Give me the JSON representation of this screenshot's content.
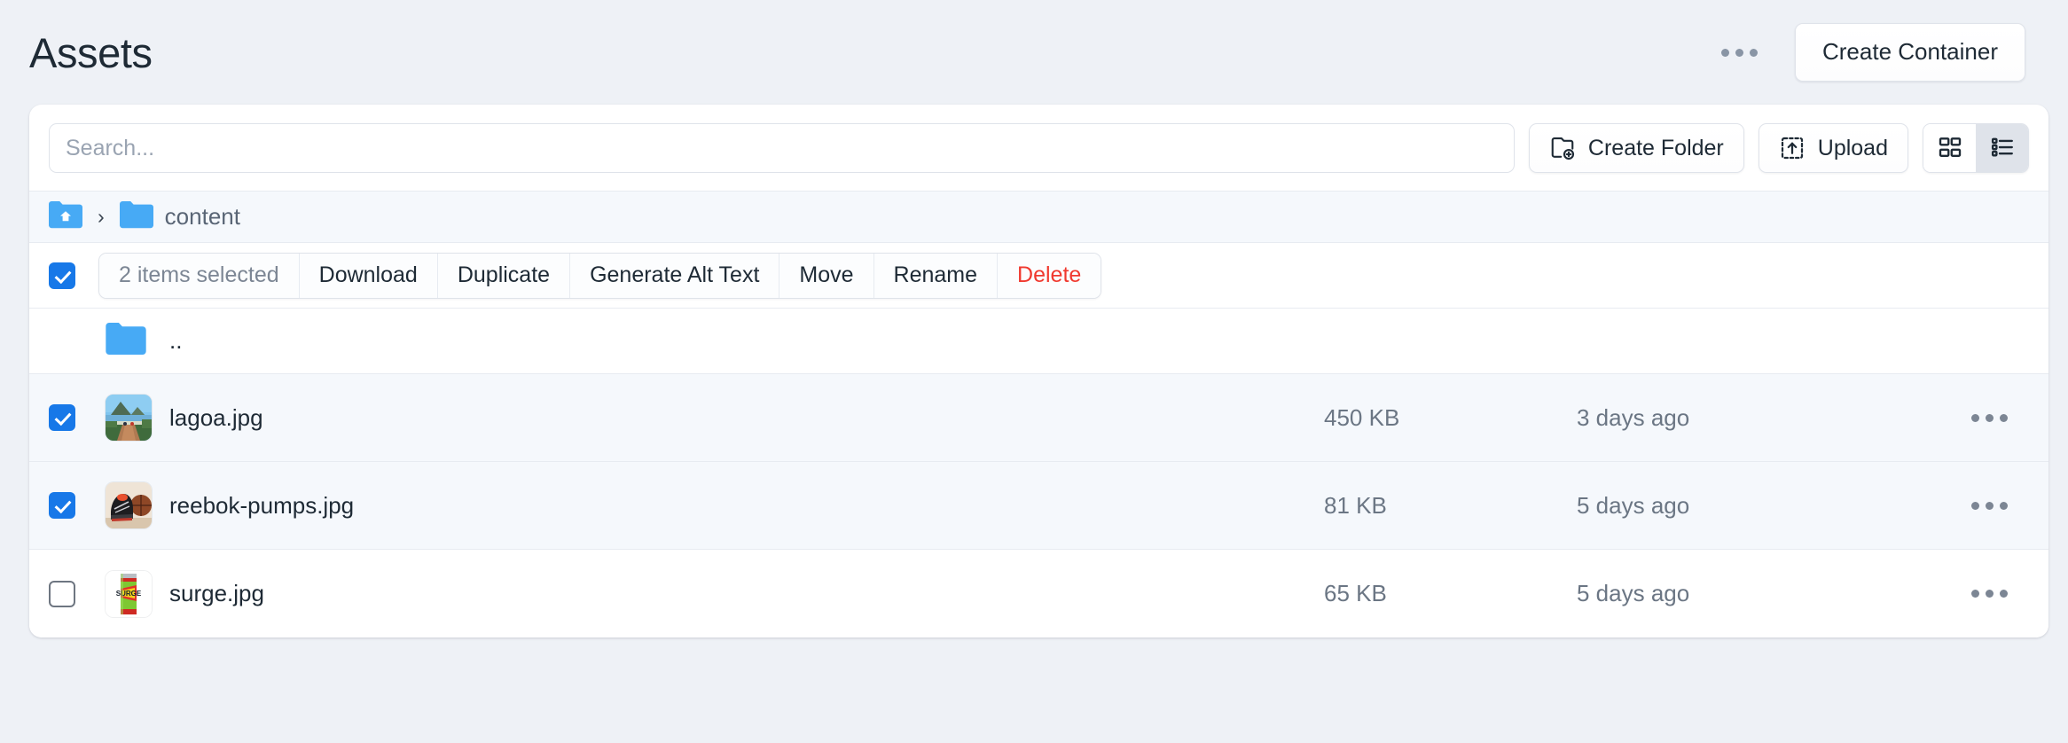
{
  "header": {
    "title": "Assets",
    "overflow_icon": "ellipsis-icon",
    "create_container_label": "Create Container"
  },
  "toolbar": {
    "search_placeholder": "Search...",
    "search_value": "",
    "create_folder_label": "Create Folder",
    "create_folder_icon": "folder-plus-icon",
    "upload_label": "Upload",
    "upload_icon": "upload-box-icon",
    "grid_view_icon": "grid-view-icon",
    "list_view_icon": "list-view-icon",
    "active_view": "list"
  },
  "breadcrumb": {
    "home_icon": "home-folder-icon",
    "separator": "›",
    "folder_icon": "folder-icon",
    "current_label": "content"
  },
  "action_bar": {
    "select_all_checked": true,
    "selection_count_label": "2 items selected",
    "buttons": [
      {
        "label": "Download",
        "style": "normal"
      },
      {
        "label": "Duplicate",
        "style": "normal"
      },
      {
        "label": "Generate Alt Text",
        "style": "normal"
      },
      {
        "label": "Move",
        "style": "normal"
      },
      {
        "label": "Rename",
        "style": "normal"
      },
      {
        "label": "Delete",
        "style": "danger"
      }
    ]
  },
  "file_list": {
    "parent_row": {
      "name": "..",
      "icon": "folder-icon"
    },
    "rows": [
      {
        "name": "lagoa.jpg",
        "size": "450 KB",
        "modified": "3 days ago",
        "selected": true,
        "thumb": "lagoon-photo",
        "menu_icon": "ellipsis-icon"
      },
      {
        "name": "reebok-pumps.jpg",
        "size": "81 KB",
        "modified": "5 days ago",
        "selected": true,
        "thumb": "sneakers-photo",
        "menu_icon": "ellipsis-icon"
      },
      {
        "name": "surge.jpg",
        "size": "65 KB",
        "modified": "5 days ago",
        "selected": false,
        "thumb": "soda-can-photo",
        "menu_icon": "ellipsis-icon"
      }
    ]
  },
  "colors": {
    "page_background": "#eef1f6",
    "card_background": "#ffffff",
    "accent_blue": "#1778e8",
    "folder_blue": "#47aaf5",
    "danger_red": "#f0392f",
    "row_selected": "#f5f8fc",
    "muted_text": "#6b7684"
  }
}
